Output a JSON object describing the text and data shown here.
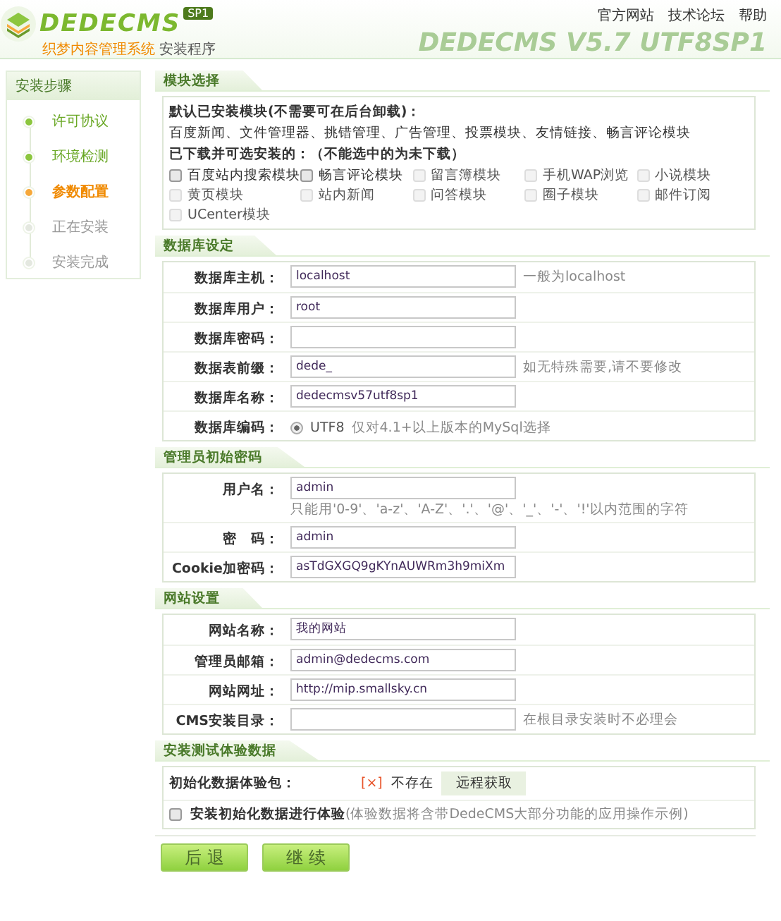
{
  "header": {
    "logo": "DEDECMS",
    "badge": "SP1",
    "product": "织梦内容管理系统",
    "subtitle": "安装程序",
    "version": "DEDECMS V5.7 UTF8SP1",
    "links": [
      "官方网站",
      "技术论坛",
      "帮助"
    ]
  },
  "sidebar": {
    "title": "安装步骤",
    "steps": [
      {
        "label": "许可协议",
        "completed": true,
        "selected": false
      },
      {
        "label": "环境检测",
        "completed": true,
        "selected": false
      },
      {
        "label": "参数配置",
        "completed": false,
        "selected": true
      },
      {
        "label": "正在安装",
        "completed": false,
        "selected": false
      },
      {
        "label": "安装完成",
        "completed": false,
        "selected": false
      }
    ]
  },
  "modules": {
    "title": "模块选择",
    "default_heading": "默认已安装模块(不需要可在后台卸载)：",
    "default_list": "百度新闻、文件管理器、挑错管理、广告管理、投票模块、友情链接、畅言评论模块",
    "optional_heading": "已下载并可选安装的：（不能选中的为未下载）",
    "options": [
      {
        "label": "百度站内搜索模块",
        "checked": false,
        "disabled": false
      },
      {
        "label": "畅言评论模块",
        "checked": false,
        "disabled": false
      },
      {
        "label": "留言簿模块",
        "checked": false,
        "disabled": true
      },
      {
        "label": "手机WAP浏览",
        "checked": false,
        "disabled": true
      },
      {
        "label": "小说模块",
        "checked": false,
        "disabled": true
      },
      {
        "label": "黄页模块",
        "checked": false,
        "disabled": true
      },
      {
        "label": "站内新闻",
        "checked": false,
        "disabled": true
      },
      {
        "label": "问答模块",
        "checked": false,
        "disabled": true
      },
      {
        "label": "圈子模块",
        "checked": false,
        "disabled": true
      },
      {
        "label": "邮件订阅",
        "checked": false,
        "disabled": true
      },
      {
        "label": "UCenter模块",
        "checked": false,
        "disabled": true
      }
    ]
  },
  "form_sections": [
    {
      "title": "数据库设定",
      "rows": [
        {
          "kind": "input",
          "label": "数据库主机：",
          "value": "localhost",
          "hint": "一般为localhost"
        },
        {
          "kind": "input",
          "label": "数据库用户：",
          "value": "root"
        },
        {
          "kind": "input",
          "label": "数据库密码："
        },
        {
          "kind": "input",
          "label": "数据表前缀：",
          "value": "dede_",
          "hint": "如无特殊需要,请不要修改"
        },
        {
          "kind": "input",
          "label": "数据库名称：",
          "value": "dedecmsv57utf8sp1"
        },
        {
          "kind": "radio",
          "label": "数据库编码：",
          "option": "UTF8",
          "selected": true,
          "note": "仅对4.1+以上版本的MySql选择"
        }
      ]
    },
    {
      "title": "管理员初始密码",
      "rows": [
        {
          "kind": "input",
          "label": "用户名：",
          "value": "admin",
          "note": "只能用'0-9'、'a-z'、'A-Z'、'.'、'@'、'_'、'-'、'!'以内范围的字符"
        },
        {
          "kind": "input",
          "label": "密　码：",
          "value": "admin"
        },
        {
          "kind": "input",
          "label": "Cookie加密码：",
          "value": "asTdGXGQ9gKYnAUWRm3h9miXm"
        }
      ]
    },
    {
      "title": "网站设置",
      "rows": [
        {
          "kind": "input",
          "label": "网站名称：",
          "value": "我的网站"
        },
        {
          "kind": "input",
          "label": "管理员邮箱：",
          "value": "admin@dedecms.com"
        },
        {
          "kind": "input",
          "label": "网站网址：",
          "value": "http://mip.smallsky.cn"
        },
        {
          "kind": "input",
          "label": "CMS安装目录：",
          "hint": "在根目录安装时不必理会"
        }
      ]
    }
  ],
  "test_data": {
    "title": "安装测试体验数据",
    "package_label": "初始化数据体验包：",
    "status_mark": "[×]",
    "status": "不存在",
    "fetch_button": "远程获取",
    "install_checked": false,
    "install_label": "安装初始化数据进行体验",
    "install_note": "(体验数据将含带DedeCMS大部分功能的应用操作示例)"
  },
  "buttons": [
    "后 退",
    "继 续"
  ]
}
